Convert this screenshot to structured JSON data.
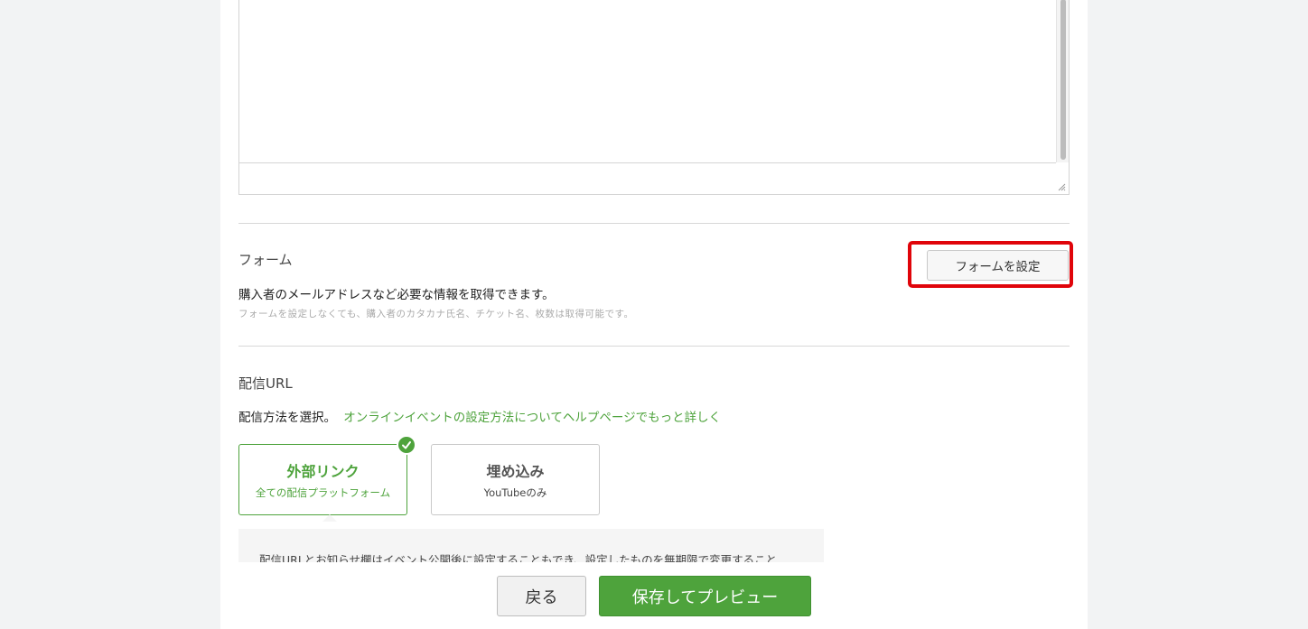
{
  "form_section": {
    "title": "フォーム",
    "description": "購入者のメールアドレスなど必要な情報を取得できます。",
    "note": "フォームを設定しなくても、購入者のカタカナ氏名、チケット名、枚数は取得可能です。",
    "button_label": "フォームを設定"
  },
  "streaming_section": {
    "title": "配信URL",
    "instruction": "配信方法を選択。",
    "help_link": "オンラインイベントの設定方法についてヘルプページでもっと詳しく",
    "options": [
      {
        "title": "外部リンク",
        "subtitle": "全ての配信プラットフォーム",
        "selected": true
      },
      {
        "title": "埋め込み",
        "subtitle": "YouTubeのみ",
        "selected": false
      }
    ],
    "info_text": "配信URLとお知らせ欄はイベント公開後に設定することもでき、設定したものを無期限で変更すること"
  },
  "footer": {
    "back_label": "戻る",
    "save_preview_label": "保存してプレビュー"
  },
  "colors": {
    "accent_green": "#4ea33c",
    "highlight_red": "#e0040a"
  },
  "icons": {
    "check": "check-icon",
    "resize": "resize-handle-icon"
  }
}
